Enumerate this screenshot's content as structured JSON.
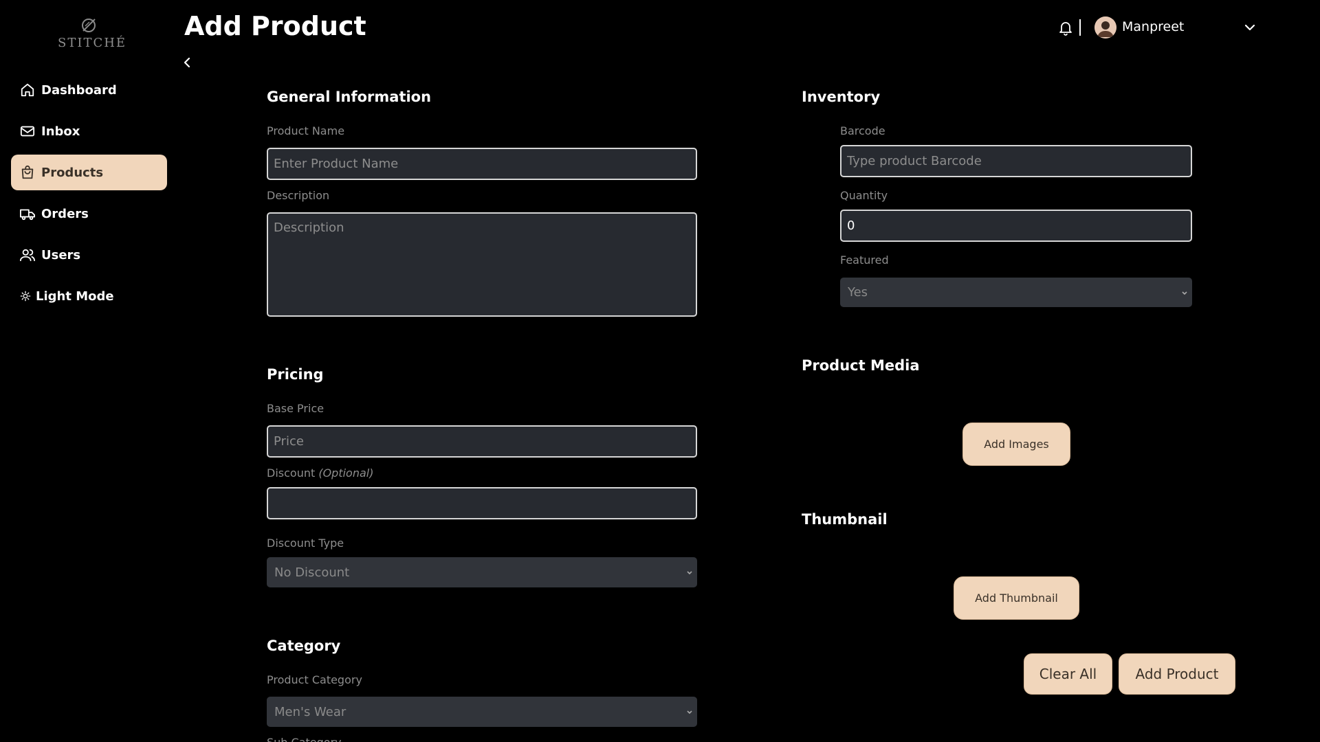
{
  "brand": {
    "name": "STITCHÉ"
  },
  "sidebar": {
    "items": [
      {
        "label": "Dashboard",
        "icon": "home-icon"
      },
      {
        "label": "Inbox",
        "icon": "mail-icon"
      },
      {
        "label": "Products",
        "icon": "shopping-bag-icon",
        "active": true
      },
      {
        "label": "Orders",
        "icon": "truck-icon"
      },
      {
        "label": "Users",
        "icon": "users-icon"
      },
      {
        "label": "Light Mode",
        "icon": "sun-icon"
      }
    ]
  },
  "header": {
    "title": "Add Product",
    "user_name": "Manpreet"
  },
  "general": {
    "title": "General Information",
    "name_label": "Product Name",
    "name_placeholder": "Enter Product Name",
    "desc_label": "Description",
    "desc_placeholder": "Description"
  },
  "pricing": {
    "title": "Pricing",
    "base_label": "Base Price",
    "base_placeholder": "Price",
    "discount_label": "Discount",
    "discount_optional": "(Optional)",
    "discount_value": "",
    "discount_type_label": "Discount Type",
    "discount_type_value": "No Discount"
  },
  "category": {
    "title": "Category",
    "product_category_label": "Product Category",
    "product_category_value": "Men's Wear",
    "sub_category_label": "Sub Category"
  },
  "inventory": {
    "title": "Inventory",
    "barcode_label": "Barcode",
    "barcode_placeholder": "Type product Barcode",
    "quantity_label": "Quantity",
    "quantity_value": "0",
    "featured_label": "Featured",
    "featured_value": "Yes"
  },
  "media": {
    "title": "Product Media",
    "add_images_label": "Add Images"
  },
  "thumbnail": {
    "title": "Thumbnail",
    "add_thumbnail_label": "Add Thumbnail"
  },
  "actions": {
    "clear_label": "Clear All",
    "submit_label": "Add Product"
  },
  "colors": {
    "accent": "#f1d6bb",
    "background": "#000000",
    "field_bg": "#272a30"
  }
}
